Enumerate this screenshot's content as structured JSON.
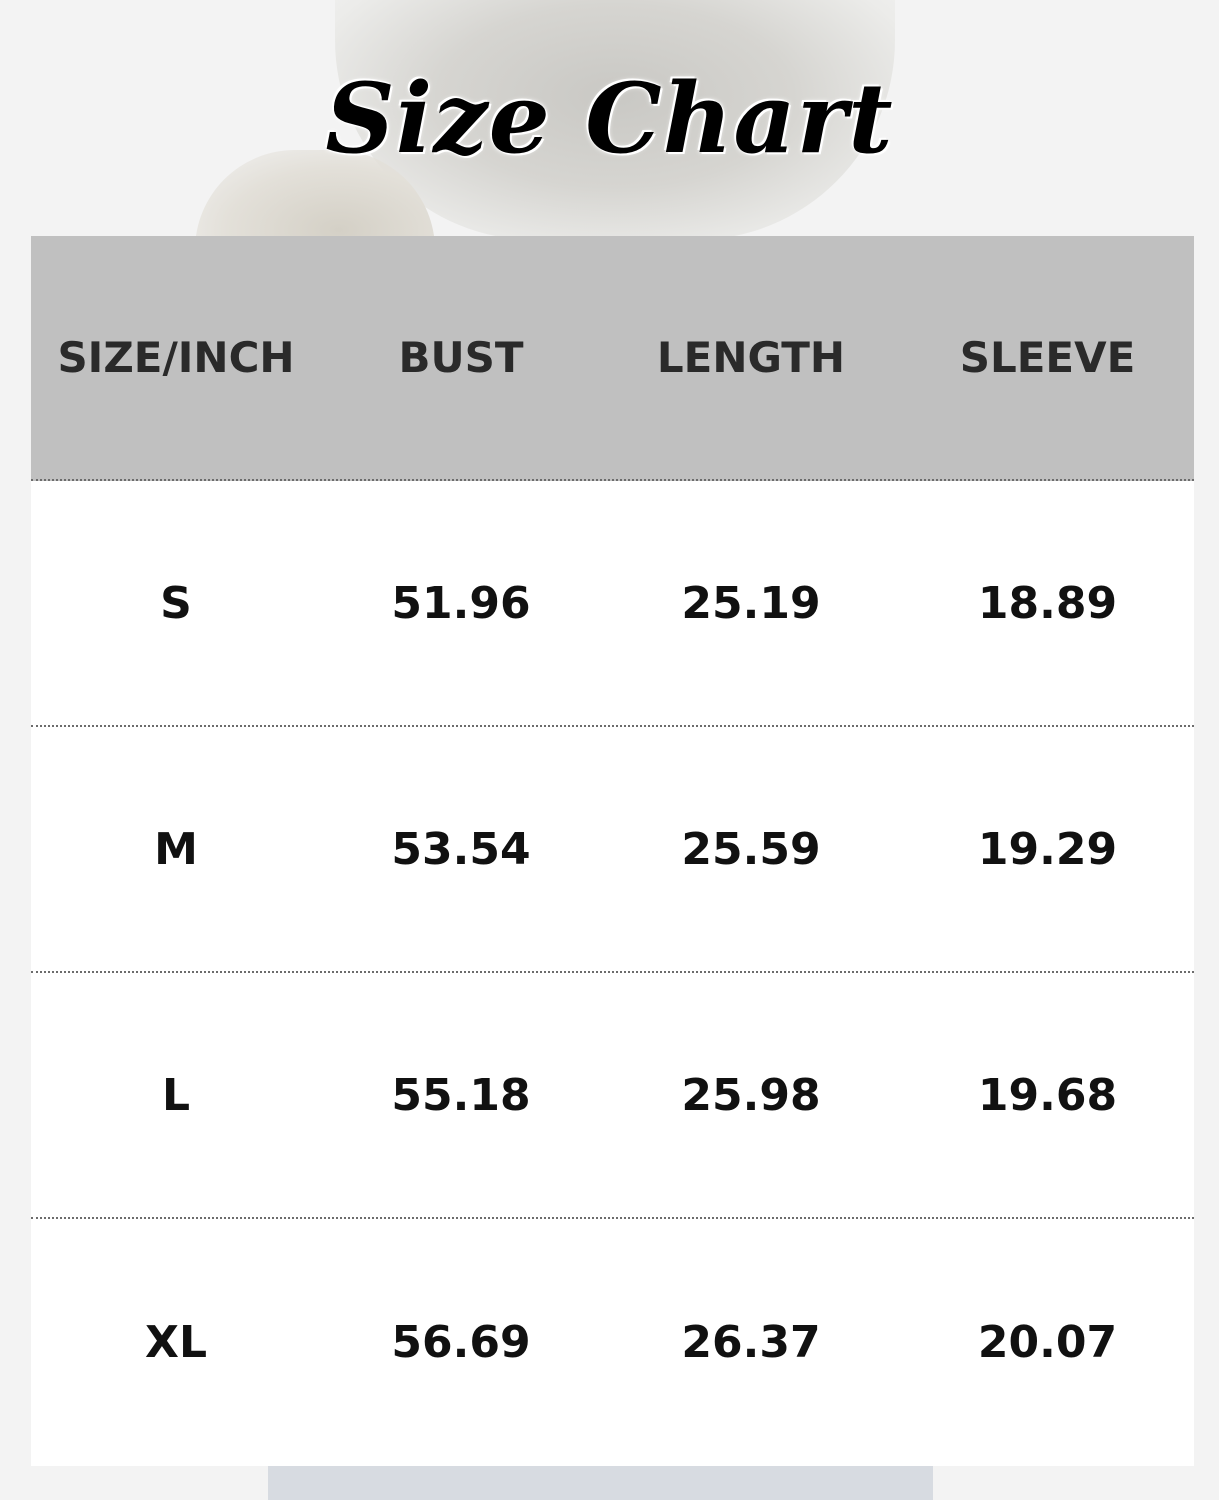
{
  "title": "Size Chart",
  "table": {
    "headers": [
      "SIZE/INCH",
      "BUST",
      "LENGTH",
      "SLEEVE"
    ],
    "rows": [
      [
        "S",
        "51.96",
        "25.19",
        "18.89"
      ],
      [
        "M",
        "53.54",
        "25.59",
        "19.29"
      ],
      [
        "L",
        "55.18",
        "25.98",
        "19.68"
      ],
      [
        "XL",
        "56.69",
        "26.37",
        "20.07"
      ]
    ]
  },
  "colors": {
    "header_background": "#c0c0c0",
    "page_background": "#f3f3f3",
    "text": "#111111"
  }
}
